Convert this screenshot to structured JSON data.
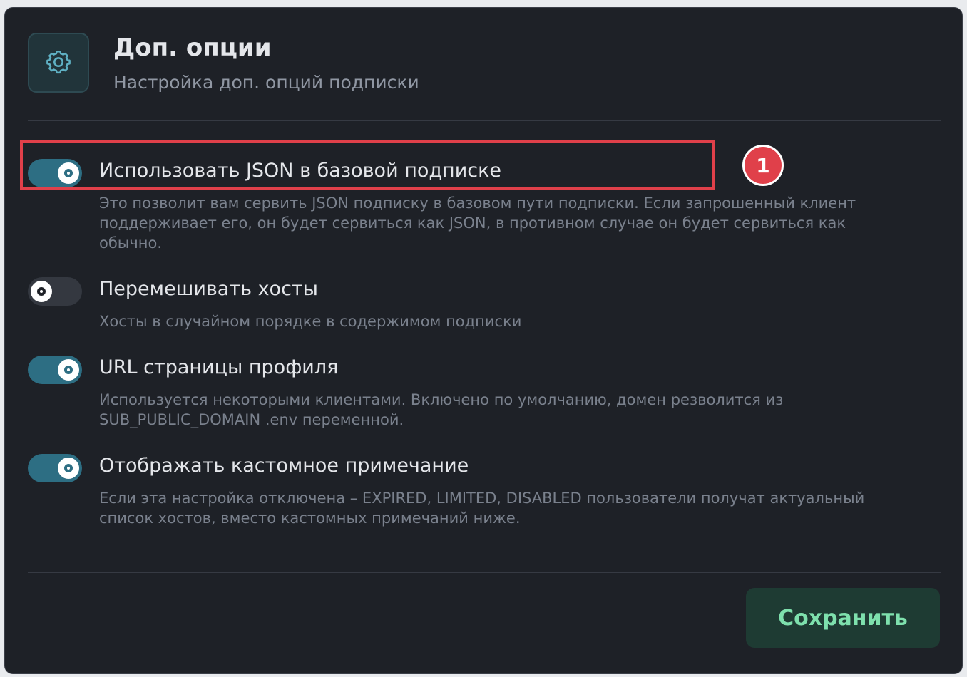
{
  "header": {
    "icon": "gear-icon",
    "title": "Доп. опции",
    "subtitle": "Настройка доп. опций подписки"
  },
  "options": [
    {
      "label": "Использовать JSON в базовой подписке",
      "description": "Это позволит вам сервить JSON подписку в базовом пути подписки. Если запрошенный клиент поддерживает его, он будет сервиться как JSON, в противном случае он будет сервиться как обычно.",
      "enabled": true
    },
    {
      "label": "Перемешивать хосты",
      "description": "Хосты в случайном порядке в содержимом подписки",
      "enabled": false
    },
    {
      "label": "URL страницы профиля",
      "description": "Используется некоторыми клиентами. Включено по умолчанию, домен резволится из SUB_PUBLIC_DOMAIN .env переменной.",
      "enabled": true
    },
    {
      "label": "Отображать кастомное примечание",
      "description": "Если эта настройка отключена – EXPIRED, LIMITED, DISABLED пользователи получат актуальный список хостов, вместо кастомных примечаний ниже.",
      "enabled": true
    }
  ],
  "annotation": {
    "marker_number": "1"
  },
  "footer": {
    "save_label": "Сохранить"
  },
  "colors": {
    "background": "#1e2127",
    "toggle_on": "#2d6e83",
    "toggle_off": "#343840",
    "accent_text": "#7ee0ad",
    "highlight": "#e0404a"
  }
}
